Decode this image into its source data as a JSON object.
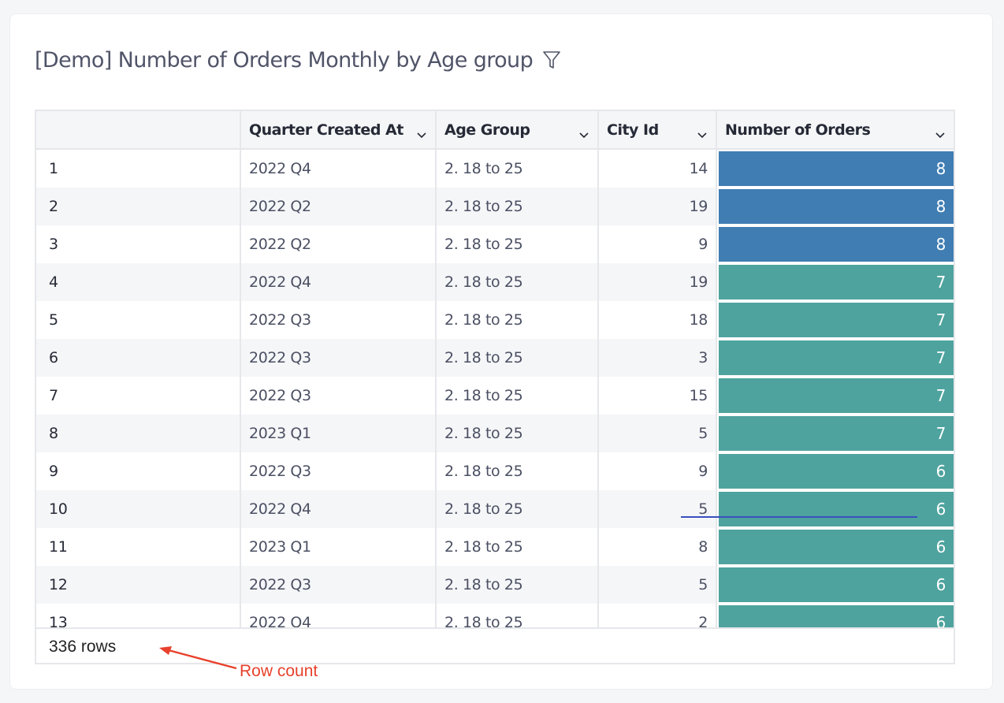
{
  "card": {
    "title": "[Demo] Number of Orders Monthly by Age group",
    "title_icon": "filter-icon"
  },
  "table": {
    "columns": [
      {
        "label": "",
        "icon": null
      },
      {
        "label": "Quarter Created At",
        "icon": "chevron-down-icon"
      },
      {
        "label": "Age Group",
        "icon": "chevron-down-icon"
      },
      {
        "label": "City Id",
        "icon": "chevron-down-icon"
      },
      {
        "label": "Number of Orders",
        "icon": "chevron-down-icon"
      }
    ],
    "rows": [
      {
        "index": "1",
        "quarter": "2022 Q4",
        "age_group": "2. 18 to 25",
        "city_id": "14",
        "orders": "8"
      },
      {
        "index": "2",
        "quarter": "2022 Q2",
        "age_group": "2. 18 to 25",
        "city_id": "19",
        "orders": "8"
      },
      {
        "index": "3",
        "quarter": "2022 Q2",
        "age_group": "2. 18 to 25",
        "city_id": "9",
        "orders": "8"
      },
      {
        "index": "4",
        "quarter": "2022 Q4",
        "age_group": "2. 18 to 25",
        "city_id": "19",
        "orders": "7"
      },
      {
        "index": "5",
        "quarter": "2022 Q3",
        "age_group": "2. 18 to 25",
        "city_id": "18",
        "orders": "7"
      },
      {
        "index": "6",
        "quarter": "2022 Q3",
        "age_group": "2. 18 to 25",
        "city_id": "3",
        "orders": "7"
      },
      {
        "index": "7",
        "quarter": "2022 Q3",
        "age_group": "2. 18 to 25",
        "city_id": "15",
        "orders": "7"
      },
      {
        "index": "8",
        "quarter": "2023 Q1",
        "age_group": "2. 18 to 25",
        "city_id": "5",
        "orders": "7"
      },
      {
        "index": "9",
        "quarter": "2022 Q3",
        "age_group": "2. 18 to 25",
        "city_id": "9",
        "orders": "6"
      },
      {
        "index": "10",
        "quarter": "2022 Q4",
        "age_group": "2. 18 to 25",
        "city_id": "5",
        "orders": "6"
      },
      {
        "index": "11",
        "quarter": "2023 Q1",
        "age_group": "2. 18 to 25",
        "city_id": "8",
        "orders": "6"
      },
      {
        "index": "12",
        "quarter": "2022 Q3",
        "age_group": "2. 18 to 25",
        "city_id": "5",
        "orders": "6"
      },
      {
        "index": "13",
        "quarter": "2022 Q4",
        "age_group": "2. 18 to 25",
        "city_id": "2",
        "orders": "6"
      }
    ],
    "color_scale": {
      "8": "#3f7db3",
      "7": "#4ea39e",
      "6": "#4ea39e"
    },
    "row_count": "336 rows"
  },
  "annotation": {
    "label": "Row count",
    "color": "#e8412c"
  }
}
